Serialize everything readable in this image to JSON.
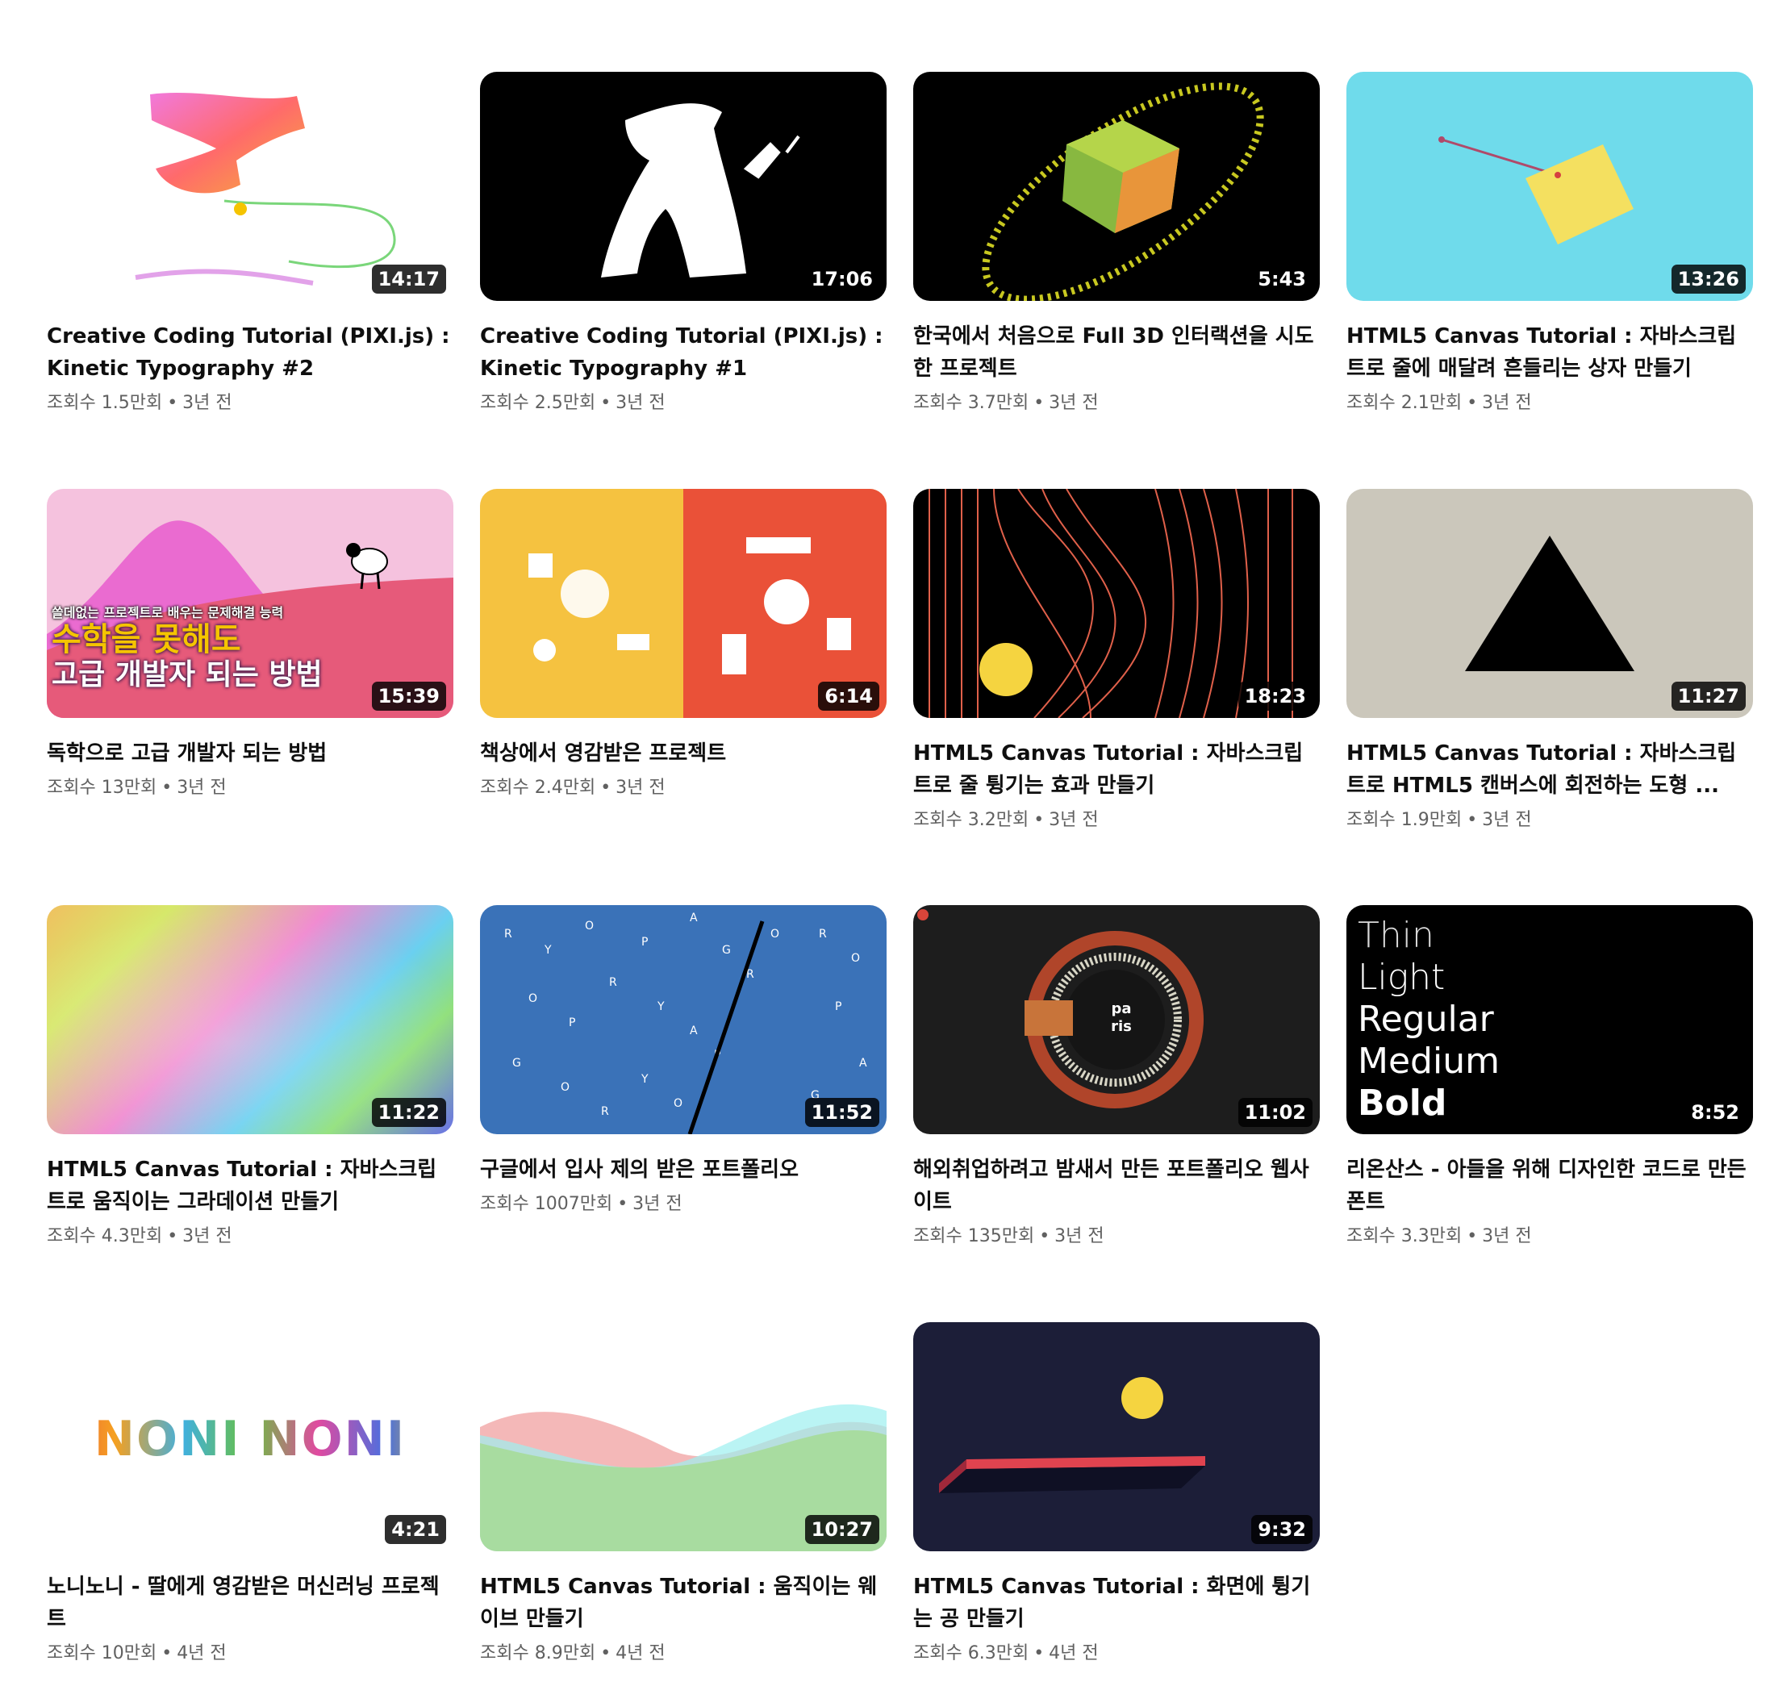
{
  "meta_separator": "•",
  "videos": [
    {
      "title": "Creative Coding Tutorial (PIXI.js) : Kinetic Typography #2",
      "views": "조회수 1.5만회",
      "age": "3년 전",
      "duration": "14:17",
      "thumb": "typo2-icon"
    },
    {
      "title": "Creative Coding Tutorial (PIXI.js) : Kinetic Typography #1",
      "views": "조회수 2.5만회",
      "age": "3년 전",
      "duration": "17:06",
      "thumb": "typo1-icon"
    },
    {
      "title": "한국에서 처음으로 Full 3D 인터랙션을 시도한 프로젝트",
      "views": "조회수 3.7만회",
      "age": "3년 전",
      "duration": "5:43",
      "thumb": "cube-icon"
    },
    {
      "title": "HTML5 Canvas Tutorial : 자바스크립트로 줄에 매달려 흔들리는 상자 만들기",
      "views": "조회수 2.1만회",
      "age": "3년 전",
      "duration": "13:26",
      "thumb": "hanging-box-icon"
    },
    {
      "title": "독학으로 고급 개발자 되는 방법",
      "views": "조회수 13만회",
      "age": "3년 전",
      "duration": "15:39",
      "thumb": "sheep-hill-icon",
      "thumb_text": {
        "line1": "쓸데없는 프로젝트로 배우는 문제해결 능력",
        "line2": "수학을 못해도",
        "line3": "고급 개발자 되는 방법"
      }
    },
    {
      "title": "책상에서 영감받은 프로젝트",
      "views": "조회수 2.4만회",
      "age": "3년 전",
      "duration": "6:14",
      "thumb": "desk-icon"
    },
    {
      "title": "HTML5 Canvas Tutorial : 자바스크립트로 줄 튕기는 효과 만들기",
      "views": "조회수 3.2만회",
      "age": "3년 전",
      "duration": "18:23",
      "thumb": "strings-icon"
    },
    {
      "title": "HTML5 Canvas Tutorial : 자바스크립트로 HTML5 캔버스에 회전하는 도형 ...",
      "views": "조회수 1.9만회",
      "age": "3년 전",
      "duration": "11:27",
      "thumb": "triangle-icon"
    },
    {
      "title": "HTML5 Canvas Tutorial : 자바스크립트로 움직이는 그라데이션 만들기",
      "views": "조회수 4.3만회",
      "age": "3년 전",
      "duration": "11:22",
      "thumb": "gradient-icon"
    },
    {
      "title": "구글에서 입사 제의 받은 포트폴리오",
      "views": "조회수 1007만회",
      "age": "3년 전",
      "duration": "11:52",
      "thumb": "letters-icon"
    },
    {
      "title": "해외취업하려고 밤새서 만든 포트폴리오 웹사이트",
      "views": "조회수 135만회",
      "age": "3년 전",
      "duration": "11:02",
      "thumb": "ring-icon",
      "thumb_text": {
        "label": "pa ris"
      }
    },
    {
      "title": "리온산스 - 아들을 위해 디자인한 코드로 만든 폰트",
      "views": "조회수 3.3만회",
      "age": "3년 전",
      "duration": "8:52",
      "thumb": "font-weights-icon",
      "thumb_text": {
        "w1": "Thin",
        "w2": "Light",
        "w3": "Regular",
        "w4": "Medium",
        "w5": "Bold"
      }
    },
    {
      "title": "노니노니 - 딸에게 영감받은 머신러닝 프로젝트",
      "views": "조회수 10만회",
      "age": "4년 전",
      "duration": "4:21",
      "thumb": "noni-icon",
      "thumb_text": {
        "word": "NONI NONI"
      }
    },
    {
      "title": "HTML5 Canvas Tutorial : 움직이는 웨이브 만들기",
      "views": "조회수 8.9만회",
      "age": "4년 전",
      "duration": "10:27",
      "thumb": "wave-icon"
    },
    {
      "title": "HTML5 Canvas Tutorial : 화면에 튕기는 공 만들기",
      "views": "조회수 6.3만회",
      "age": "4년 전",
      "duration": "9:32",
      "thumb": "bounce-ball-icon"
    }
  ]
}
